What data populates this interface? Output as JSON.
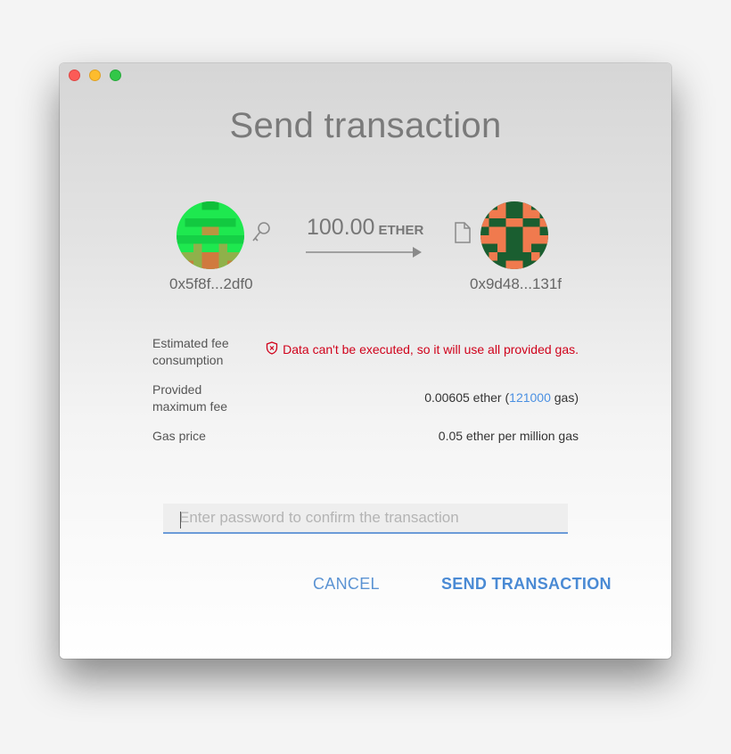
{
  "window": {
    "title": "Send transaction"
  },
  "from": {
    "address": "0x5f8f...2df0",
    "icon": "key-icon",
    "avatar_colors": [
      "#1ee84f",
      "#8fb14a",
      "#d07a3e"
    ]
  },
  "transfer": {
    "amount": "100.00",
    "unit": "ETHER"
  },
  "to": {
    "address": "0x9d48...131f",
    "icon": "document-icon",
    "avatar_colors": [
      "#1a5e30",
      "#f07a4e"
    ]
  },
  "details": {
    "fee_label": "Estimated fee consumption",
    "fee_warning": "Data can't be executed, so it will use all provided gas.",
    "max_fee_label": "Provided maximum fee",
    "max_fee_ether": "0.00605 ether (",
    "max_fee_gas": "121000",
    "max_fee_suffix": " gas)",
    "gas_price_label": "Gas price",
    "gas_price_value": "0.05 ether per million gas"
  },
  "password": {
    "placeholder": "Enter password to confirm the transaction",
    "value": ""
  },
  "actions": {
    "cancel_label": "CANCEL",
    "send_label": "SEND TRANSACTION"
  },
  "colors": {
    "accent": "#4a90e2",
    "warning": "#d0021b"
  }
}
